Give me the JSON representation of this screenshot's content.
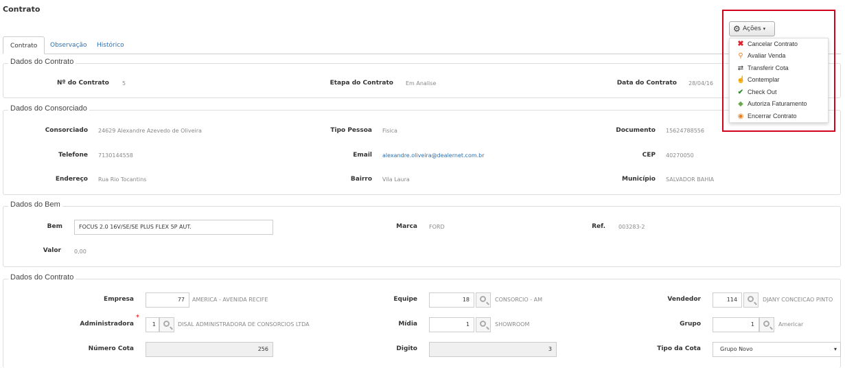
{
  "page": {
    "title": "Contrato"
  },
  "tabs": [
    {
      "label": "Contrato"
    },
    {
      "label": "Observação"
    },
    {
      "label": "Histórico"
    }
  ],
  "actions": {
    "button_label": "Ações",
    "items": [
      {
        "label": "Cancelar Contrato",
        "icon": "cancel-x-icon",
        "color": "#d9232d"
      },
      {
        "label": "Avaliar Venda",
        "icon": "search-orange-icon",
        "color": "#e67e22"
      },
      {
        "label": "Transferir Cota",
        "icon": "transfer-arrows-icon",
        "color": "#333333"
      },
      {
        "label": "Contemplar",
        "icon": "thumbs-up-icon",
        "color": "#555555"
      },
      {
        "label": "Check Out",
        "icon": "check-icon",
        "color": "#2e8b2e"
      },
      {
        "label": "Autoriza Faturamento",
        "icon": "money-icon",
        "color": "#6aa84f"
      },
      {
        "label": "Encerrar Contrato",
        "icon": "close-circle-icon",
        "color": "#e67e22"
      }
    ]
  },
  "dados_contrato": {
    "legend": "Dados do Contrato",
    "numero_label": "Nº do Contrato",
    "numero": "5",
    "etapa_label": "Etapa do Contrato",
    "etapa": "Em Analise",
    "data_label": "Data do Contrato",
    "data": "28/04/16"
  },
  "dados_consorciado": {
    "legend": "Dados do Consorciado",
    "consorciado_label": "Consorciado",
    "consorciado": "24629   Alexandre Azevedo de Oliveira",
    "tipo_label": "Tipo Pessoa",
    "tipo": "Fisica",
    "documento_label": "Documento",
    "documento": "15624788556",
    "telefone_label": "Telefone",
    "telefone": "7130144558",
    "email_label": "Email",
    "email": "alexandre.oliveira@dealernet.com.br",
    "cep_label": "CEP",
    "cep": "40270050",
    "endereco_label": "Endereço",
    "endereco": "Rua Rio Tocantins",
    "bairro_label": "Bairro",
    "bairro": "Vila Laura",
    "municipio_label": "Município",
    "municipio": "SALVADOR   BAHIA"
  },
  "dados_bem": {
    "legend": "Dados do Bem",
    "bem_label": "Bem",
    "bem": "FOCUS 2.0 16V/SE/SE PLUS FLEX 5P AUT.",
    "marca_label": "Marca",
    "marca": "FORD",
    "ref_label": "Ref.",
    "ref": "003283-2",
    "valor_label": "Valor",
    "valor": "0,00"
  },
  "dados_contrato2": {
    "legend": "Dados do Contrato",
    "empresa_label": "Empresa",
    "empresa_code": "77",
    "empresa_name": "AMERICA - AVENIDA RECIFE",
    "equipe_label": "Equipe",
    "equipe_code": "18",
    "equipe_name": "CONSORCIO - AM",
    "vendedor_label": "Vendedor",
    "vendedor_code": "114",
    "vendedor_name": "DJANY CONCEICAO PINTO",
    "administradora_label": "Administradora",
    "required_mark": "*",
    "administradora_code": "1",
    "administradora_name": "DISAL ADMINISTRADORA DE CONSORCIOS LTDA",
    "midia_label": "Mídia",
    "midia_code": "1",
    "midia_name": "SHOWROOM",
    "grupo_label": "Grupo",
    "grupo_code": "1",
    "grupo_name": "Americar",
    "numero_cota_label": "Número Cota",
    "numero_cota": "256",
    "digito_label": "Digito",
    "digito": "3",
    "tipo_cota_label": "Tipo da Cota",
    "tipo_cota": "Grupo Novo"
  }
}
